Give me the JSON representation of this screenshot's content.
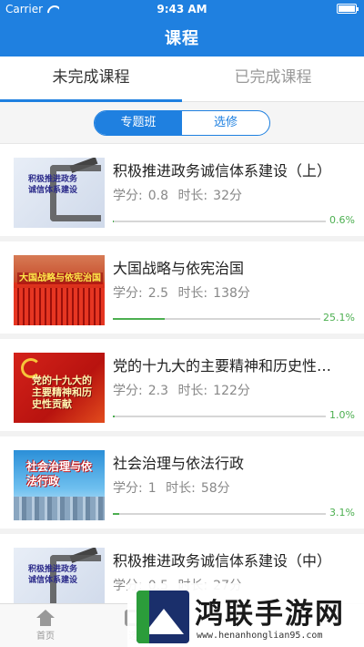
{
  "status_bar": {
    "carrier": "Carrier",
    "time": "9:43 AM"
  },
  "header": {
    "title": "课程"
  },
  "tabs": [
    {
      "label": "未完成课程",
      "active": true
    },
    {
      "label": "已完成课程",
      "active": false
    }
  ],
  "segment": [
    {
      "label": "专题班",
      "active": true
    },
    {
      "label": "选修",
      "active": false
    }
  ],
  "meta_labels": {
    "credit": "学分:",
    "duration": "时长:"
  },
  "courses": [
    {
      "title": "积极推进政务诚信体系建设（上）",
      "credit": "0.8",
      "duration": "32分",
      "progress": "0.6%",
      "progress_value": 0.006,
      "thumb_text": "积极推进政务诚信体系建设"
    },
    {
      "title": "大国战略与依宪治国",
      "credit": "2.5",
      "duration": "138分",
      "progress": "25.1%",
      "progress_value": 0.251,
      "thumb_text": "大国战略与依宪治国"
    },
    {
      "title": "党的十九大的主要精神和历史性贡献",
      "credit": "2.3",
      "duration": "122分",
      "progress": "1.0%",
      "progress_value": 0.01,
      "thumb_text": "党的十九大的主要精神和历史性贡献"
    },
    {
      "title": "社会治理与依法行政",
      "credit": "1",
      "duration": "58分",
      "progress": "3.1%",
      "progress_value": 0.031,
      "thumb_text": "社会治理与依法行政"
    },
    {
      "title": "积极推进政务诚信体系建设（中）",
      "credit": "0.5",
      "duration": "27分",
      "progress": "",
      "progress_value": null,
      "thumb_text": "积极推进政务诚信体系建设"
    }
  ],
  "tabbar": [
    {
      "label": "首页",
      "icon": "home-icon"
    },
    {
      "label": "选",
      "icon": "select-icon"
    }
  ],
  "watermark": {
    "title": "鸿联手游网",
    "url": "www.henanhonglian95.com"
  },
  "colors": {
    "primary": "#1f80e0",
    "progress": "#4caf50"
  }
}
